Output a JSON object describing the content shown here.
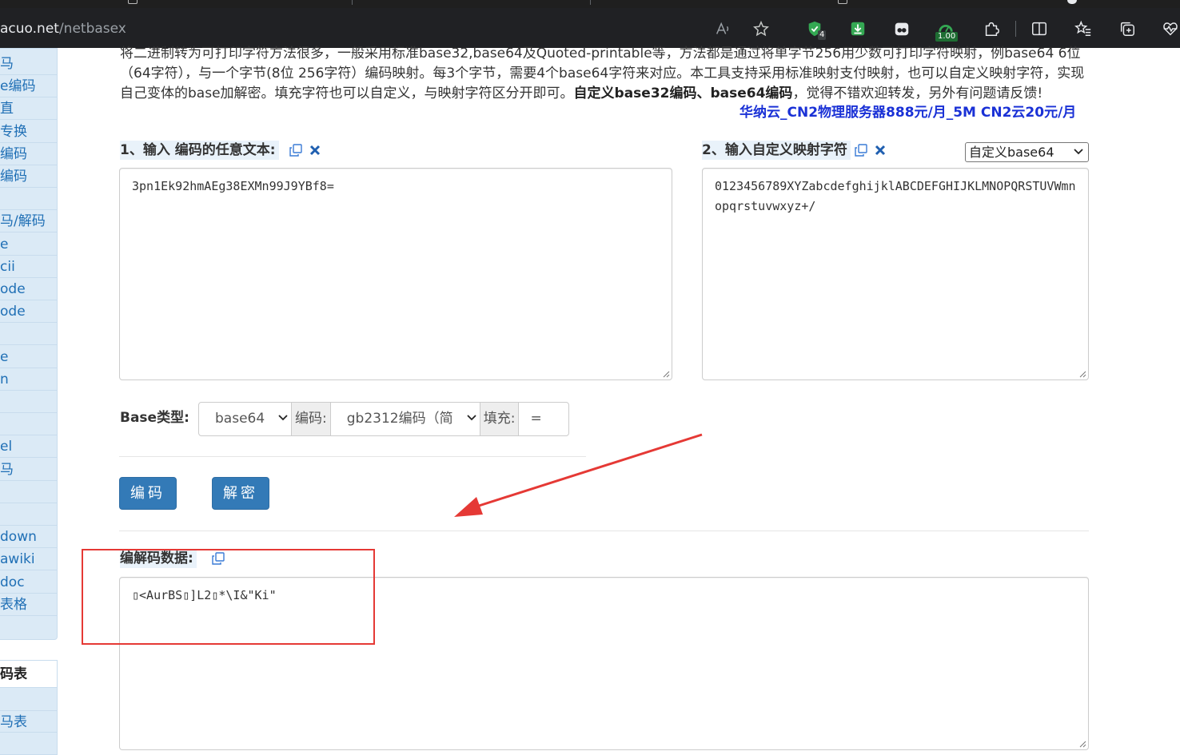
{
  "browser": {
    "url_host": "acuo.net",
    "url_path": "/netbasex",
    "extension_badge_count": "4",
    "extension_badge_value": "1.00",
    "icons": [
      "read-aloud-icon",
      "favorite-star-icon",
      "shield-extension-icon",
      "download-extension-icon",
      "ghost-extension-icon",
      "speed-extension-icon",
      "puzzle-extensions-icon",
      "split-screen-icon",
      "favorites-list-icon",
      "collections-icon",
      "performance-icon"
    ]
  },
  "sidebar": {
    "items": [
      {
        "label": "马"
      },
      {
        "label": "e编码"
      },
      {
        "label": "直"
      },
      {
        "label": "专换"
      },
      {
        "label": "编码"
      },
      {
        "label": "编码"
      },
      {
        "label": ""
      },
      {
        "label": "马/解码"
      },
      {
        "label": "e"
      },
      {
        "label": "cii"
      },
      {
        "label": "ode"
      },
      {
        "label": "ode"
      },
      {
        "label": ""
      },
      {
        "label": "e"
      },
      {
        "label": "n"
      },
      {
        "label": ""
      },
      {
        "label": ""
      },
      {
        "label": "el"
      },
      {
        "label": "马"
      },
      {
        "label": ""
      },
      {
        "label": ""
      },
      {
        "label": "down"
      },
      {
        "label": "awiki"
      },
      {
        "label": "doc"
      },
      {
        "label": "表格"
      }
    ],
    "group_title": "码表",
    "group_item": "马表"
  },
  "intro": {
    "line1": "将二进制转为可打印字符方法很多，一般采用标准base32,base64及Quoted-printable等，方法都是通过将单字节256用少数可打印字符映射，例base64 6位（64字符），与一个字节(8位 256字符）编码映射。每3个字节，需要4个base64字符来对应。本工具支持采用标准映射支付映射，也可以自定义映射字符，实现自己变体的base加解密。填充字符也可以自定义，与映射字符区分开即可。",
    "bold_part": "自定义base32编码、base64编码",
    "tail": "，觉得不错欢迎转发，另外有问题请反馈!",
    "ad_link": "华纳云_CN2物理服务器888元/月_5M CN2云20元/月"
  },
  "input_panel": {
    "label": "1、输入 编码的任意文本:",
    "value": "3pn1Ek92hmAEg38EXMn99J9YBf8="
  },
  "mapping_panel": {
    "label": "2、输入自定义映射字符",
    "value": "0123456789XYZabcdefghijklABCDEFGHIJKLMNOPQRSTUVWmnopqrstuvwxyz+/",
    "preset_selected": "自定义base64"
  },
  "options": {
    "base_label": "Base类型:",
    "base_type_selected": "base64",
    "encoding_label": "编码:",
    "encoding_selected": "gb2312编码（简",
    "padding_label": "填充:",
    "padding_value": "="
  },
  "actions": {
    "encode_label": "编码",
    "decode_label": "解密"
  },
  "output_panel": {
    "label": "编解码数据:",
    "value": "▯<AurBS▯]L2▯*\\I&\"Ki\""
  },
  "colors": {
    "accent_blue": "#337ab7",
    "link_blue": "#1a31d6",
    "annotation_red": "#e53935",
    "sidebar_bg": "#dbeaf6"
  }
}
